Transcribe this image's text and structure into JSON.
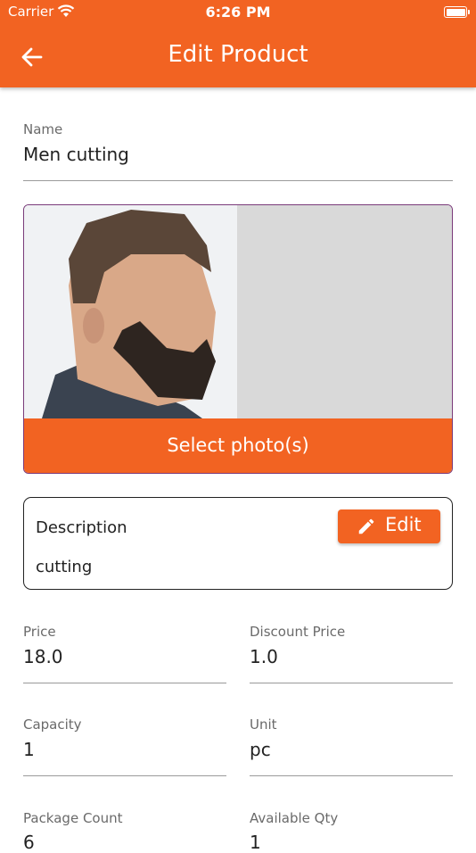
{
  "status_bar": {
    "carrier": "Carrier",
    "time": "6:26 PM"
  },
  "header": {
    "title": "Edit Product",
    "back_icon": "arrow-left-icon"
  },
  "accent_color": "#f26322",
  "name_field": {
    "label": "Name",
    "value": "Men cutting"
  },
  "photo": {
    "select_label": "Select photo(s)"
  },
  "description": {
    "label": "Description",
    "value": "cutting",
    "edit_label": "Edit",
    "edit_icon": "pencil-icon"
  },
  "price": {
    "label": "Price",
    "value": "18.0"
  },
  "discount_price": {
    "label": "Discount Price",
    "value": "1.0"
  },
  "capacity": {
    "label": "Capacity",
    "value": "1"
  },
  "unit": {
    "label": "Unit",
    "value": "pc"
  },
  "package_count": {
    "label": "Package Count",
    "value": "6"
  },
  "available_qty": {
    "label": "Available Qty",
    "value": "1"
  }
}
